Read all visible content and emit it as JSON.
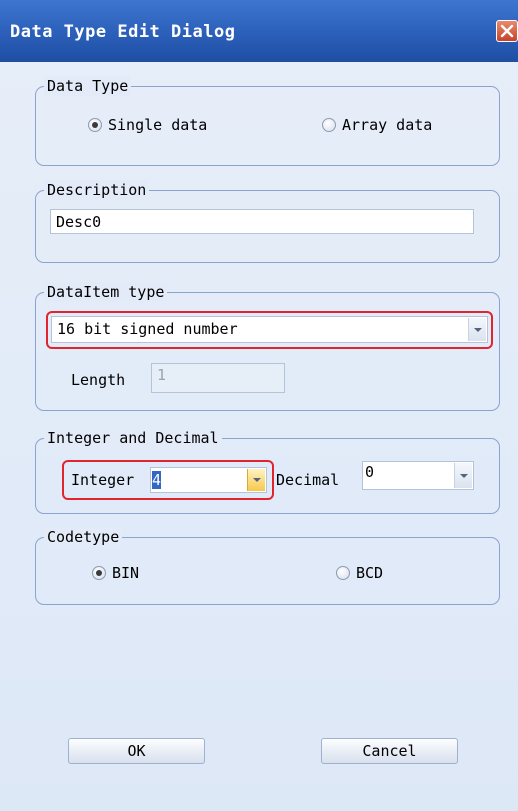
{
  "window": {
    "title": "Data Type Edit Dialog"
  },
  "data_type": {
    "legend": "Data Type",
    "options": [
      {
        "label": "Single data",
        "selected": true
      },
      {
        "label": "Array data",
        "selected": false
      }
    ]
  },
  "description": {
    "legend": "Description",
    "value": "Desc0"
  },
  "dataitem_type": {
    "legend": "DataItem type",
    "selected": "16 bit signed number",
    "length_label": "Length",
    "length_value": "1"
  },
  "integer_decimal": {
    "legend": "Integer and Decimal",
    "integer_label": "Integer",
    "integer_value": "4",
    "decimal_label": "Decimal",
    "decimal_value": "0"
  },
  "codetype": {
    "legend": "Codetype",
    "options": [
      {
        "label": "BIN",
        "selected": true
      },
      {
        "label": "BCD",
        "selected": false
      }
    ]
  },
  "buttons": {
    "ok": "OK",
    "cancel": "Cancel"
  },
  "colors": {
    "title_bar": "#2b5fb9",
    "highlight": "#e0252c",
    "group_border": "#8aa4cf",
    "selection": "#3167c7"
  }
}
